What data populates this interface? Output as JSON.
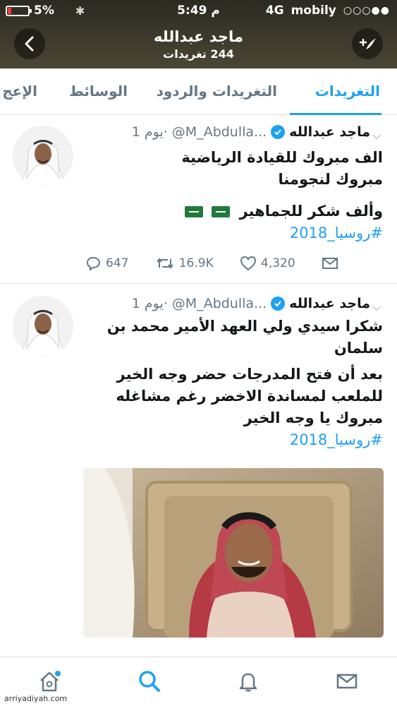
{
  "status_bar": {
    "battery": "5%",
    "time": "5:49 م",
    "network": "4G",
    "carrier": "mobily"
  },
  "header": {
    "name": "ماجد عبدالله",
    "tweet_count": "244 تغريدات"
  },
  "tabs": [
    {
      "label": "التغريدات",
      "active": true
    },
    {
      "label": "التغريدات والردود",
      "active": false
    },
    {
      "label": "الوسائط",
      "active": false
    },
    {
      "label": "الإعج",
      "active": false
    }
  ],
  "tweets": [
    {
      "name": "ماجد عبدالله",
      "handle": "@M_Abdulla...",
      "time": "1 يوم·",
      "lines": [
        "الف مبروك للقيادة الرياضية",
        "مبروك لنجومنا",
        "وألف شكر للجماهير"
      ],
      "hashtag": "#روسيا_2018",
      "replies": "647",
      "retweets": "16.9K",
      "likes": "4,320"
    },
    {
      "name": "ماجد عبدالله",
      "handle": "@M_Abdulla...",
      "time": "1 يوم·",
      "lines": [
        "شكرا سيدي ولي العهد الأمير محمد بن",
        "سلمان",
        "بعد أن فتح المدرجات حضر وجه الخير",
        "للملعب لمساندة الاخضر رغم مشاغله",
        "مبروك يا وجه الخير"
      ],
      "hashtag": "#روسيا_2018"
    }
  ],
  "icons": {
    "back": "chevron-left-icon",
    "compose": "compose-icon",
    "verified": "verified-badge-icon",
    "reply": "reply-icon",
    "retweet": "retweet-icon",
    "like": "heart-icon",
    "dm": "envelope-icon",
    "nav": [
      "home-icon",
      "search-icon",
      "bell-icon",
      "mail-icon"
    ]
  },
  "colors": {
    "accent": "#1da1f2",
    "muted": "#657786",
    "text": "#14171a"
  },
  "watermark": "arriyadiyah.com"
}
